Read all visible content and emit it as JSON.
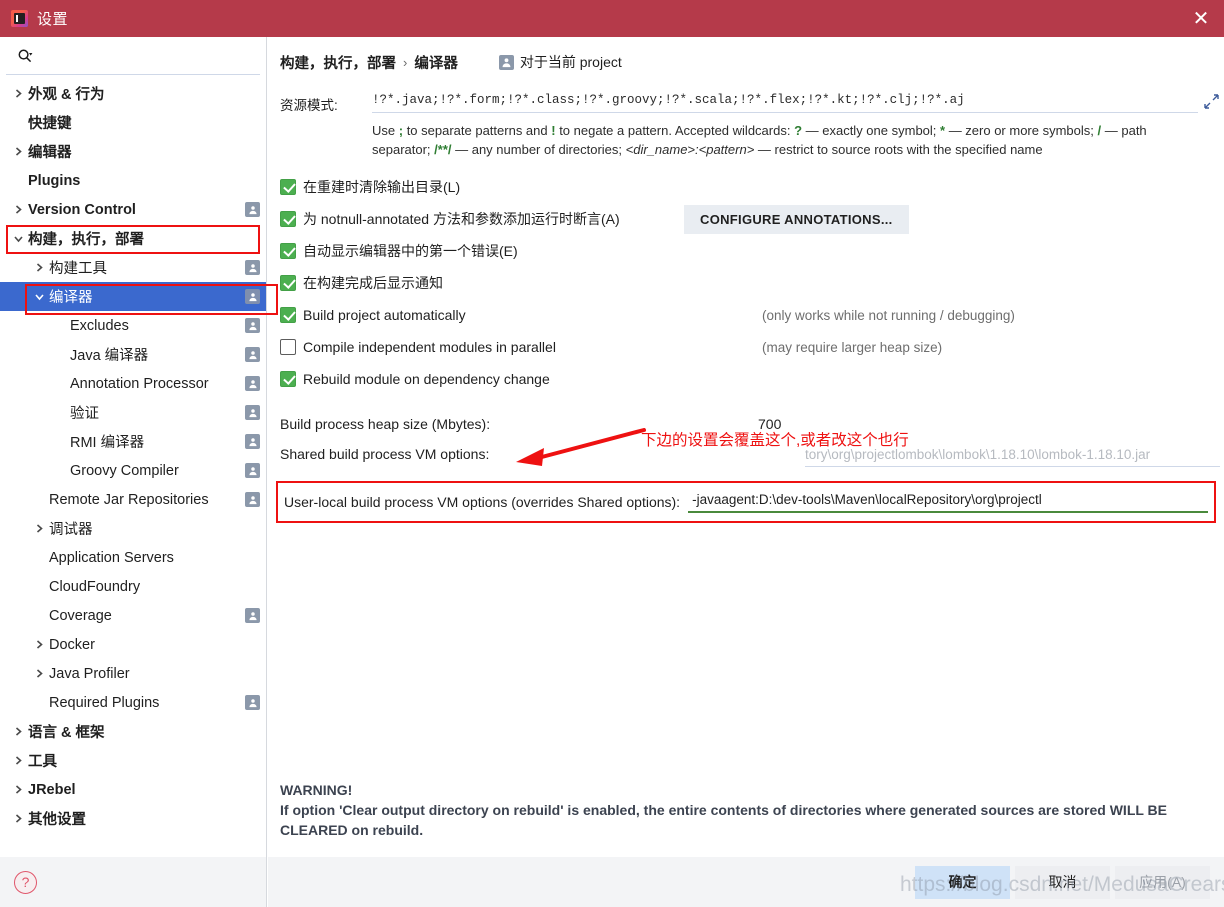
{
  "window": {
    "title": "设置",
    "app_icon": "intellij-idea-icon",
    "close_icon": "close-icon",
    "titlebar_color": "#b53a4a"
  },
  "sidebar": {
    "search": {
      "placeholder": "",
      "value": "",
      "icon": "search-icon"
    },
    "items": [
      {
        "label": "外观 & 行为",
        "level": 0,
        "arrow": "right",
        "bold": true,
        "badge": false,
        "selected": false
      },
      {
        "label": "快捷键",
        "level": 0,
        "arrow": "none",
        "bold": true,
        "badge": false,
        "selected": false
      },
      {
        "label": "编辑器",
        "level": 0,
        "arrow": "right",
        "bold": true,
        "badge": false,
        "selected": false
      },
      {
        "label": "Plugins",
        "level": 0,
        "arrow": "none",
        "bold": true,
        "badge": false,
        "selected": false
      },
      {
        "label": "Version Control",
        "level": 0,
        "arrow": "right",
        "bold": true,
        "badge": true,
        "selected": false
      },
      {
        "label": "构建，执行，部署",
        "level": 0,
        "arrow": "down",
        "bold": true,
        "badge": false,
        "selected": false
      },
      {
        "label": "构建工具",
        "level": 1,
        "arrow": "right",
        "bold": false,
        "badge": true,
        "selected": false
      },
      {
        "label": "编译器",
        "level": 1,
        "arrow": "down",
        "bold": false,
        "badge": true,
        "selected": true
      },
      {
        "label": "Excludes",
        "level": 2,
        "arrow": "none",
        "bold": false,
        "badge": true,
        "selected": false
      },
      {
        "label": "Java 编译器",
        "level": 2,
        "arrow": "none",
        "bold": false,
        "badge": true,
        "selected": false
      },
      {
        "label": "Annotation Processor",
        "level": 2,
        "arrow": "none",
        "bold": false,
        "badge": true,
        "selected": false
      },
      {
        "label": "验证",
        "level": 2,
        "arrow": "none",
        "bold": false,
        "badge": true,
        "selected": false
      },
      {
        "label": "RMI 编译器",
        "level": 2,
        "arrow": "none",
        "bold": false,
        "badge": true,
        "selected": false
      },
      {
        "label": "Groovy Compiler",
        "level": 2,
        "arrow": "none",
        "bold": false,
        "badge": true,
        "selected": false
      },
      {
        "label": "Remote Jar Repositories",
        "level": 1,
        "arrow": "none",
        "bold": false,
        "badge": true,
        "selected": false
      },
      {
        "label": "调试器",
        "level": 1,
        "arrow": "right",
        "bold": false,
        "badge": false,
        "selected": false
      },
      {
        "label": "Application Servers",
        "level": 1,
        "arrow": "none",
        "bold": false,
        "badge": false,
        "selected": false
      },
      {
        "label": "CloudFoundry",
        "level": 1,
        "arrow": "none",
        "bold": false,
        "badge": false,
        "selected": false
      },
      {
        "label": "Coverage",
        "level": 1,
        "arrow": "none",
        "bold": false,
        "badge": true,
        "selected": false
      },
      {
        "label": "Docker",
        "level": 1,
        "arrow": "right",
        "bold": false,
        "badge": false,
        "selected": false
      },
      {
        "label": "Java Profiler",
        "level": 1,
        "arrow": "right",
        "bold": false,
        "badge": false,
        "selected": false
      },
      {
        "label": "Required Plugins",
        "level": 1,
        "arrow": "none",
        "bold": false,
        "badge": true,
        "selected": false
      },
      {
        "label": "语言 & 框架",
        "level": 0,
        "arrow": "right",
        "bold": true,
        "badge": false,
        "selected": false
      },
      {
        "label": "工具",
        "level": 0,
        "arrow": "right",
        "bold": true,
        "badge": false,
        "selected": false
      },
      {
        "label": "JRebel",
        "level": 0,
        "arrow": "right",
        "bold": true,
        "badge": false,
        "selected": false
      },
      {
        "label": "其他设置",
        "level": 0,
        "arrow": "right",
        "bold": true,
        "badge": false,
        "selected": false
      }
    ],
    "help_icon": "help-question-icon"
  },
  "main": {
    "breadcrumb": {
      "root": "构建，执行，部署",
      "separator": "›",
      "leaf": "编译器"
    },
    "scope": {
      "icon": "project-scope-icon",
      "text": "对于当前 project"
    },
    "resource_patterns": {
      "label": "资源模式:",
      "value": "!?*.java;!?*.form;!?*.class;!?*.groovy;!?*.scala;!?*.flex;!?*.kt;!?*.clj;!?*.aj",
      "expand_icon": "expand-diagonal-icon",
      "help_parts": {
        "p1": "Use ",
        "t1": ";",
        "p2": " to separate patterns and ",
        "t2": "!",
        "p3": " to negate a pattern. Accepted wildcards: ",
        "t3": "?",
        "p4": " — exactly one symbol; ",
        "t4": "*",
        "p5": " — zero or more symbols; ",
        "t5": "/",
        "p6": " — path separator; ",
        "t6": "/**/",
        "p7": " — any number of directories; ",
        "i1": "<dir_name>:<pattern>",
        "p8": " — restrict to source roots with the specified name"
      }
    },
    "checkboxes": [
      {
        "label": "在重建时清除输出目录(L)",
        "checked": true,
        "note": ""
      },
      {
        "label": "为 notnull-annotated 方法和参数添加运行时断言(A)",
        "checked": true,
        "note": ""
      },
      {
        "label": "自动显示编辑器中的第一个错误(E)",
        "checked": true,
        "note": ""
      },
      {
        "label": "在构建完成后显示通知",
        "checked": true,
        "note": ""
      },
      {
        "label": "Build project automatically",
        "checked": true,
        "note": "(only works while not running / debugging)"
      },
      {
        "label": "Compile independent modules in parallel",
        "checked": false,
        "note": "(may require larger heap size)"
      },
      {
        "label": "Rebuild module on dependency change",
        "checked": true,
        "note": ""
      }
    ],
    "configure_annotations_button": "CONFIGURE ANNOTATIONS...",
    "heap": {
      "label": "Build process heap size (Mbytes):",
      "value": "700"
    },
    "shared_vm": {
      "label": "Shared build process VM options:",
      "value": "tory\\org\\projectlombok\\lombok\\1.18.10\\lombok-1.18.10.jar"
    },
    "user_local_vm": {
      "label": "User-local build process VM options (overrides Shared options):",
      "value": "-javaagent:D:\\dev-tools\\Maven\\localRepository\\org\\projectl"
    },
    "warning": {
      "title": "WARNING!",
      "body": "If option 'Clear output directory on rebuild' is enabled, the entire contents of directories where generated sources are stored WILL BE CLEARED on rebuild."
    }
  },
  "annotations": {
    "note_text": "下边的设置会覆盖这个,或者改这个也行",
    "color": "#ee1111"
  },
  "footer": {
    "ok": "确定",
    "cancel": "取消",
    "apply": "应用(A)"
  },
  "watermark": "https://blog.csdn.net/MedusaCrears"
}
